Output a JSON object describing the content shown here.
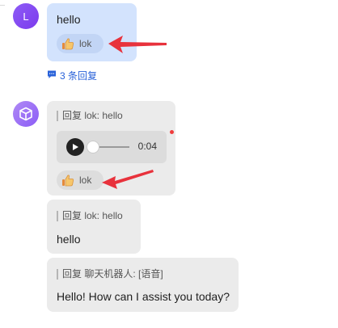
{
  "user_message": {
    "avatar_initial": "L",
    "text": "hello",
    "reaction": {
      "emoji": "thumbs-up-icon",
      "user": "lok"
    },
    "replies_label": "3 条回复"
  },
  "bot_messages": [
    {
      "quote_prefix": "回复 lok:",
      "quote_text": "hello",
      "audio": {
        "duration": "0:04",
        "progress": 0
      },
      "reaction": {
        "emoji": "thumbs-up-icon",
        "user": "lok"
      },
      "unread": true
    },
    {
      "quote_prefix": "回复 lok:",
      "quote_text": "hello",
      "text": "hello"
    },
    {
      "quote_prefix": "回复 聊天机器人:",
      "quote_text": "[语音]",
      "text": "Hello! How can I assist you today?"
    }
  ],
  "colors": {
    "user_bubble": "#d3e3fd",
    "bot_bubble": "#ebebeb",
    "link": "#2962d9",
    "annotation_arrow": "#e8323c",
    "avatar": "#7c3aed"
  }
}
